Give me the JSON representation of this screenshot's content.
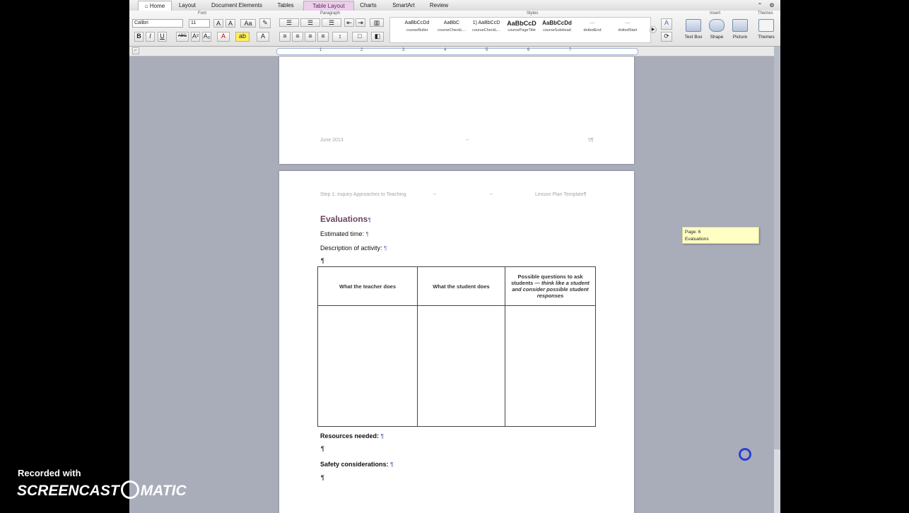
{
  "ribbon": {
    "tabs": [
      "Home",
      "Layout",
      "Document Elements",
      "Tables",
      "Table Layout",
      "Charts",
      "SmartArt",
      "Review"
    ],
    "groups": {
      "font": "Font",
      "paragraph": "Paragraph",
      "styles": "Styles",
      "insert": "Insert",
      "themes": "Themes"
    },
    "font_name": "Calibri",
    "font_size": "11",
    "styles": [
      {
        "sample": "AaBbCcDd",
        "name": "courseBullet"
      },
      {
        "sample": "AaBbC",
        "name": "courseCheckL..."
      },
      {
        "sample": "1) AaBbCcD",
        "name": "courseCheckL..."
      },
      {
        "sample": "AaBbCcD",
        "name": "coursePageTitle"
      },
      {
        "sample": "AaBbCcDd",
        "name": "courseSubHead"
      },
      {
        "sample": "—",
        "name": "dottedEnd"
      },
      {
        "sample": "—",
        "name": "dottedStart"
      }
    ],
    "insert": [
      "Text Box",
      "Shape",
      "Picture"
    ],
    "themes_label": "Themes"
  },
  "ruler": {
    "numbers": [
      "1",
      "2",
      "3",
      "4",
      "5",
      "6",
      "7"
    ]
  },
  "page5": {
    "footer_left": "June 2013",
    "footer_arrow": "→",
    "footer_right": "5¶"
  },
  "page6": {
    "header_left": "Step 1: Inquiry Approaches to Teaching",
    "header_arrow1": "→",
    "header_arrow2": "→",
    "header_right": "Lesson Plan Template¶",
    "heading": "Evaluations",
    "estimated_time": "Estimated time:",
    "description": "Description of activity:",
    "pilcrow": "¶",
    "table_headers": [
      "What the teacher does",
      "What the student does"
    ],
    "table_header3_a": "Possible questions to ask students — ",
    "table_header3_b": "think like a student and consider possible student",
    "table_header3_c": " responses",
    "resources": "Resources needed:",
    "safety": "Safety considerations:"
  },
  "tooltip": {
    "line1": "Page: 6",
    "line2": "Evaluations"
  },
  "watermark": {
    "line1": "Recorded with",
    "line2": "SCREENCAST",
    "line3": "MATIC"
  }
}
